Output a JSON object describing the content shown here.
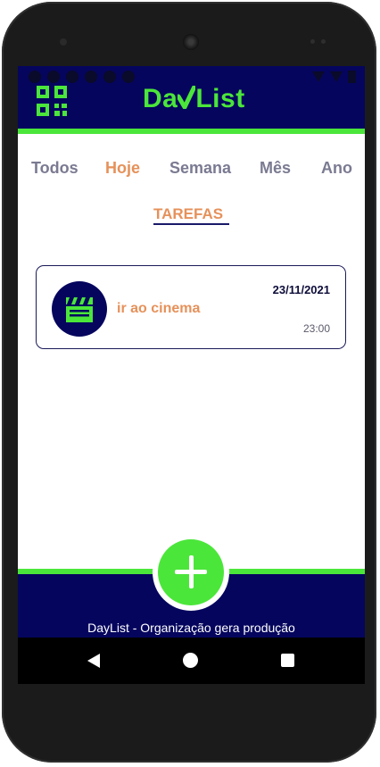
{
  "app": {
    "title": "DayList",
    "brand_part1": "Da",
    "brand_check": "y",
    "brand_part2": "List"
  },
  "tabs": [
    {
      "label": "Todos",
      "active": false
    },
    {
      "label": "Hoje",
      "active": true
    },
    {
      "label": "Semana",
      "active": false
    },
    {
      "label": "Mês",
      "active": false
    },
    {
      "label": "Ano",
      "active": false
    }
  ],
  "section": {
    "title": "TAREFAS"
  },
  "tasks": [
    {
      "name": "ir ao cinema",
      "date": "23/11/2021",
      "time": "23:00",
      "icon": "clapperboard-icon"
    }
  ],
  "footer": {
    "text": "DayList - Organização gera produção"
  },
  "colors": {
    "primary": "#05055e",
    "accent_green": "#4be63a",
    "accent_orange": "#e6915a",
    "tab_inactive": "#7a7a92"
  },
  "icons": {
    "app_logo": "qr-code-icon",
    "fab": "plus-icon",
    "nav_back": "back-triangle-icon",
    "nav_home": "home-circle-icon",
    "nav_recent": "recent-square-icon"
  }
}
